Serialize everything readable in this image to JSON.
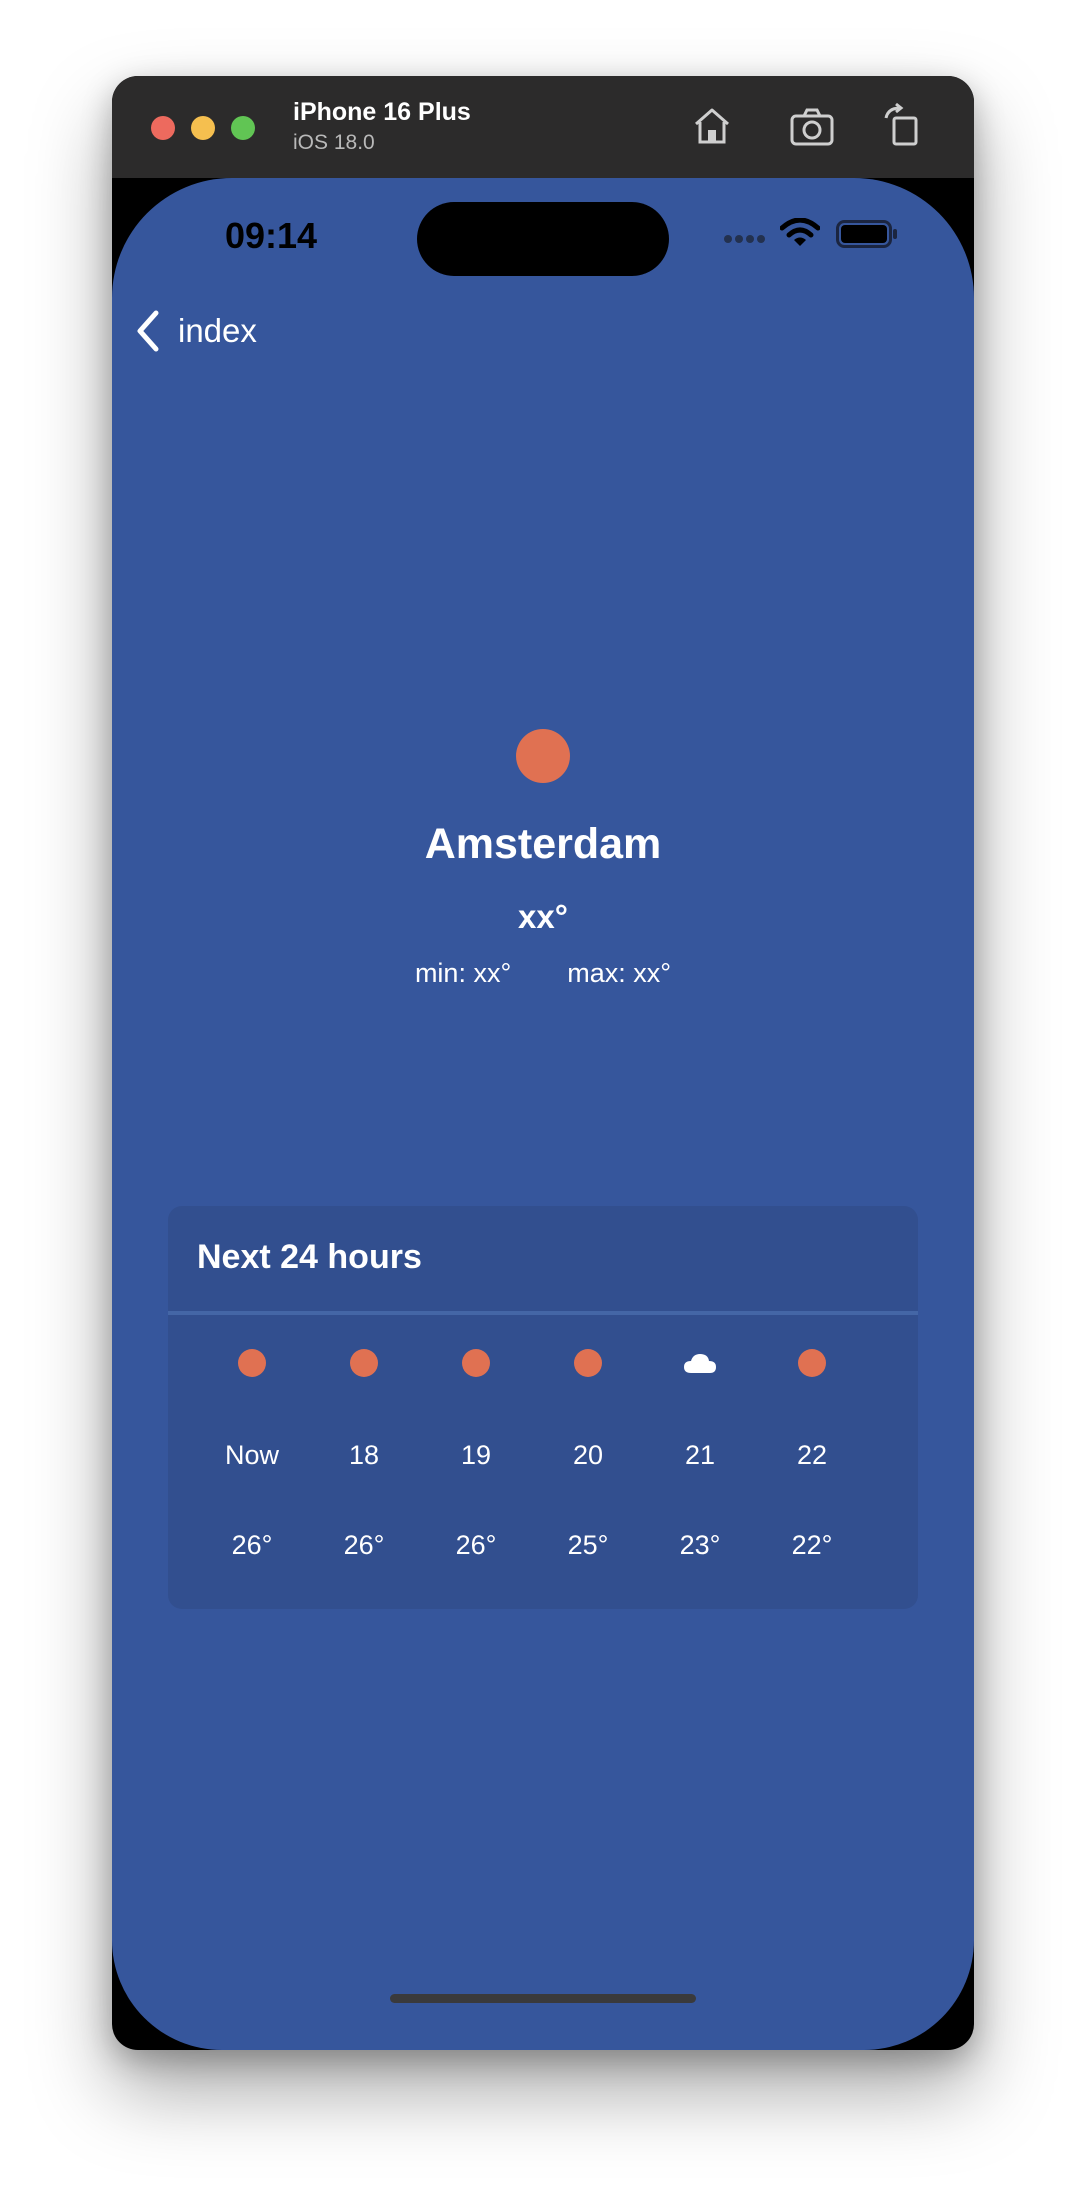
{
  "simulator": {
    "device_name": "iPhone 16 Plus",
    "os_version": "iOS 18.0",
    "toolbar_icons": [
      "home-icon",
      "screenshot-icon",
      "rotate-icon"
    ]
  },
  "status_bar": {
    "time": "09:14"
  },
  "navigation": {
    "back_label": "index"
  },
  "weather": {
    "icon": "sun-icon",
    "city": "Amsterdam",
    "current_temp": "xx°",
    "min": "min: xx°",
    "max": "max: xx°"
  },
  "forecast": {
    "title": "Next 24 hours",
    "hours": [
      {
        "label": "Now",
        "temp": "26°",
        "icon": "sun-icon"
      },
      {
        "label": "18",
        "temp": "26°",
        "icon": "sun-icon"
      },
      {
        "label": "19",
        "temp": "26°",
        "icon": "sun-icon"
      },
      {
        "label": "20",
        "temp": "25°",
        "icon": "sun-icon"
      },
      {
        "label": "21",
        "temp": "23°",
        "icon": "cloud-icon"
      },
      {
        "label": "22",
        "temp": "22°",
        "icon": "sun-icon"
      }
    ]
  },
  "colors": {
    "background": "#36569c",
    "card": "#324f8f",
    "sun": "#e07152",
    "text": "#ffffff"
  }
}
